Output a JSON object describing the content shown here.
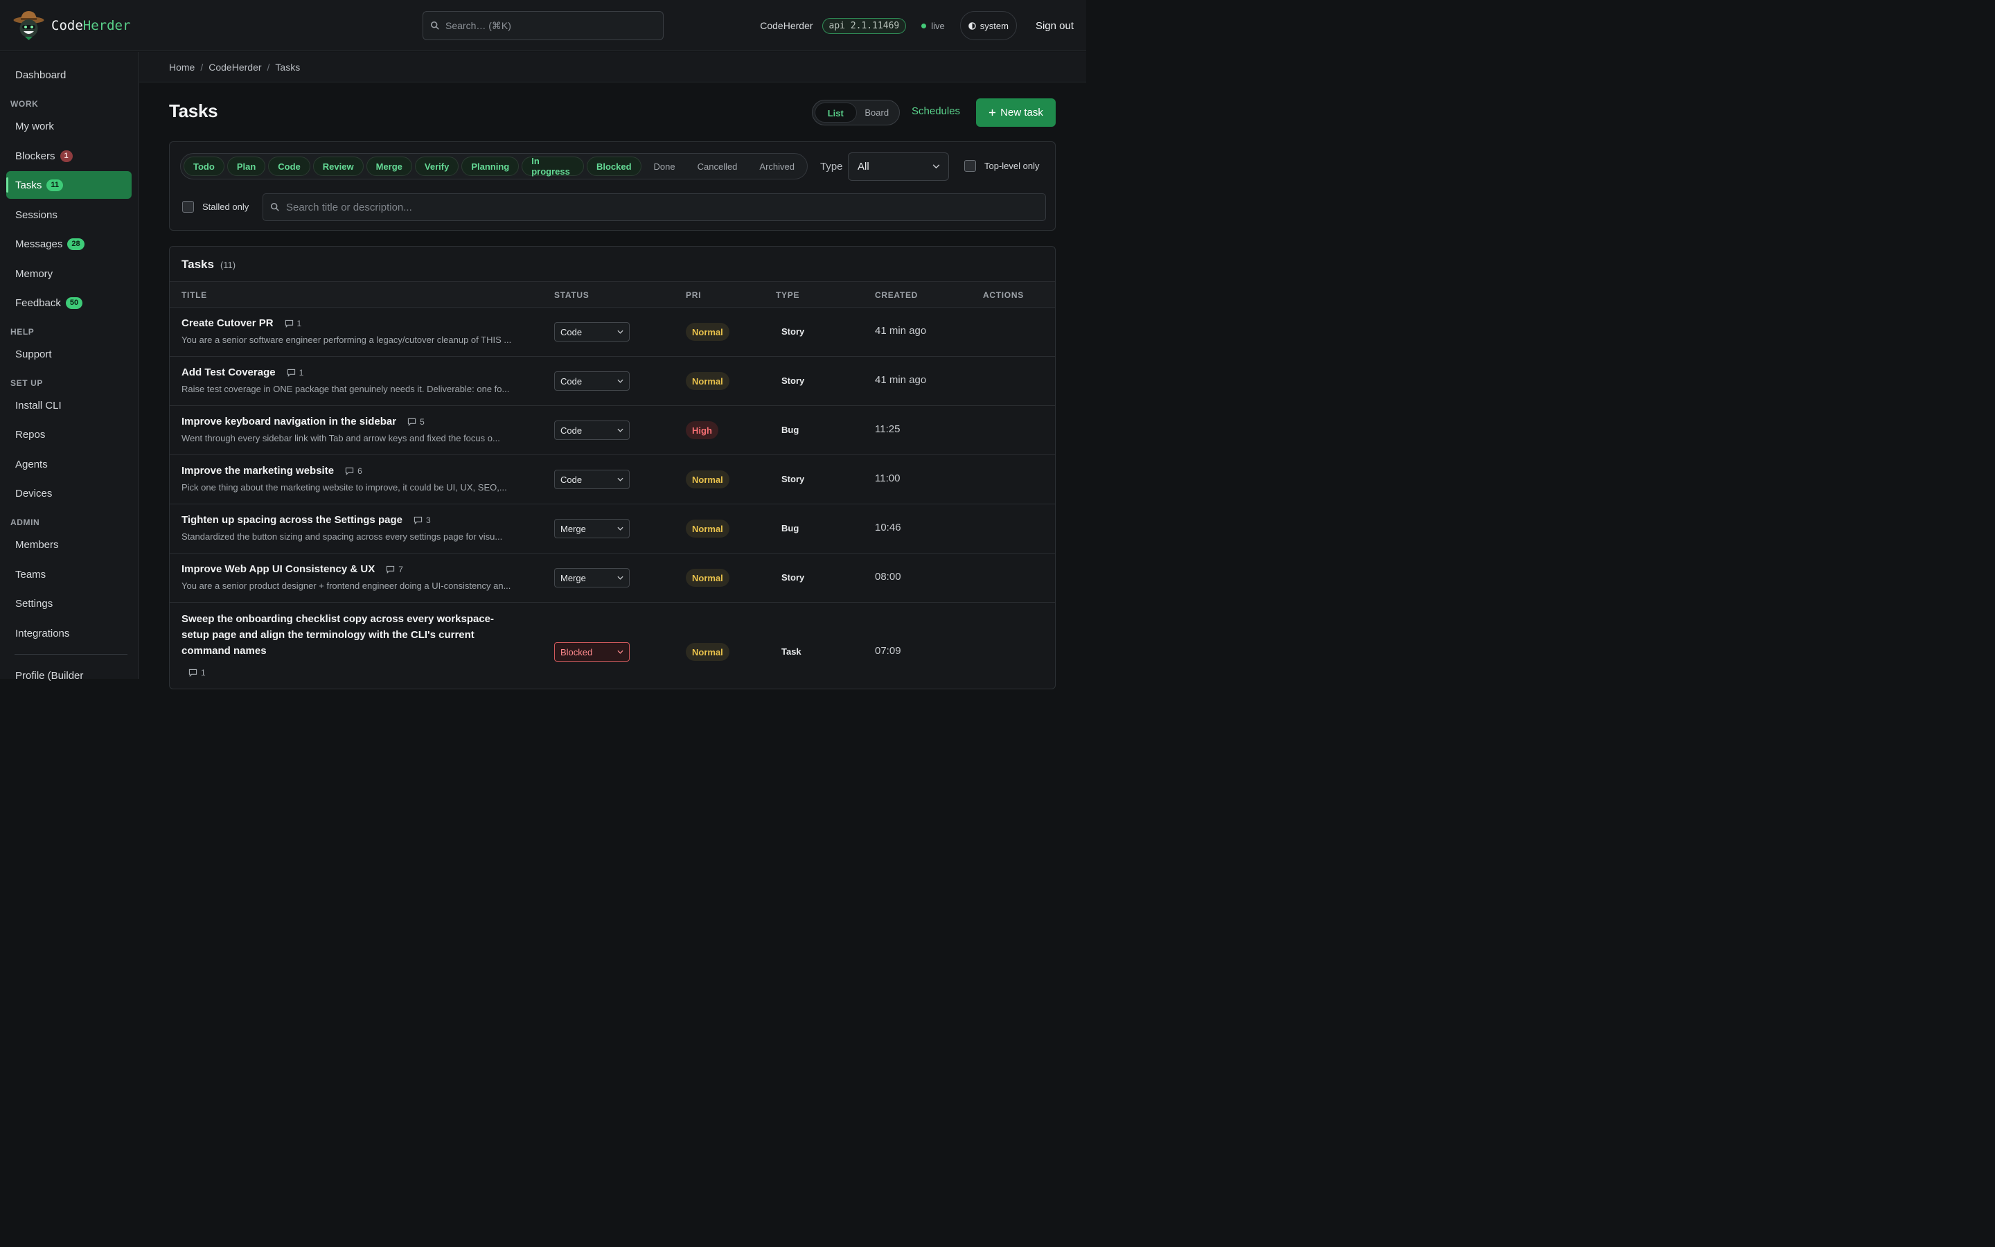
{
  "brand": {
    "name_main": "Code",
    "name_accent": "Herder"
  },
  "top": {
    "search_placeholder": "Search… (⌘K)",
    "org": "CodeHerder",
    "api_version": "api 2.1.11469",
    "live": "live",
    "theme": "system",
    "sign_out": "Sign out"
  },
  "sidebar": {
    "dashboard": "Dashboard",
    "sections": {
      "work": "WORK",
      "help": "HELP",
      "setup": "SET UP",
      "admin": "ADMIN"
    },
    "work": [
      {
        "label": "My work"
      },
      {
        "label": "Blockers",
        "count": "1"
      },
      {
        "label": "Tasks",
        "count": "11"
      },
      {
        "label": "Sessions"
      },
      {
        "label": "Messages",
        "count": "28"
      },
      {
        "label": "Memory"
      },
      {
        "label": "Feedback",
        "count": "50"
      }
    ],
    "help": [
      {
        "label": "Support"
      }
    ],
    "setup": [
      {
        "label": "Install CLI"
      },
      {
        "label": "Repos"
      },
      {
        "label": "Agents"
      },
      {
        "label": "Devices"
      }
    ],
    "admin": [
      {
        "label": "Members"
      },
      {
        "label": "Teams"
      },
      {
        "label": "Settings"
      },
      {
        "label": "Integrations"
      }
    ],
    "profile": "Profile (Builder"
  },
  "breadcrumb": [
    "Home",
    "CodeHerder",
    "Tasks"
  ],
  "page": {
    "title": "Tasks",
    "view_list": "List",
    "view_board": "Board",
    "schedules": "Schedules",
    "new_task": "New task"
  },
  "filters": {
    "status_chips_on": [
      "Todo",
      "Plan",
      "Code",
      "Review",
      "Merge",
      "Verify",
      "Planning",
      "In progress",
      "Blocked"
    ],
    "status_chips_off": [
      "Done",
      "Cancelled",
      "Archived"
    ],
    "type_label": "Type",
    "type_value": "All",
    "top_level_only": "Top-level only",
    "stalled_only": "Stalled only",
    "search_placeholder": "Search title or description..."
  },
  "table": {
    "title": "Tasks",
    "count": "(11)",
    "headers": {
      "title": "TITLE",
      "status": "STATUS",
      "pri": "PRI",
      "type": "TYPE",
      "created": "CREATED",
      "actions": "ACTIONS"
    },
    "rows": [
      {
        "title": "Create Cutover PR",
        "comments": "1",
        "desc": "You are a senior software engineer performing a legacy/cutover cleanup of THIS ...",
        "status": "Code",
        "pri": "Normal",
        "type": "Story",
        "created": "41 min ago"
      },
      {
        "title": "Add Test Coverage",
        "comments": "1",
        "desc": "Raise test coverage in ONE package that genuinely needs it. Deliverable: one fo...",
        "status": "Code",
        "pri": "Normal",
        "type": "Story",
        "created": "41 min ago"
      },
      {
        "title": "Improve keyboard navigation in the sidebar",
        "comments": "5",
        "desc": "Went through every sidebar link with Tab and arrow keys and fixed the focus o...",
        "status": "Code",
        "pri": "High",
        "type": "Bug",
        "created": "11:25"
      },
      {
        "title": "Improve the marketing website",
        "comments": "6",
        "desc": "Pick one thing about the marketing website to improve, it could be UI, UX, SEO,...",
        "status": "Code",
        "pri": "Normal",
        "type": "Story",
        "created": "11:00"
      },
      {
        "title": "Tighten up spacing across the Settings page",
        "comments": "3",
        "desc": "Standardized the button sizing and spacing across every settings page for visu...",
        "status": "Merge",
        "pri": "Normal",
        "type": "Bug",
        "created": "10:46"
      },
      {
        "title": "Improve Web App UI Consistency & UX",
        "comments": "7",
        "desc": "You are a senior product designer + frontend engineer doing a UI-consistency an...",
        "status": "Merge",
        "pri": "Normal",
        "type": "Story",
        "created": "08:00"
      },
      {
        "title": "Sweep the onboarding checklist copy across every workspace-setup page and align the terminology with the CLI's current command names",
        "comments": "1",
        "desc": "",
        "status": "Blocked",
        "pri": "Normal",
        "type": "Task",
        "created": "07:09"
      }
    ]
  },
  "colors": {
    "accent": "#59d08a",
    "primary_button": "#1f8b4c",
    "bg": "#111315"
  }
}
